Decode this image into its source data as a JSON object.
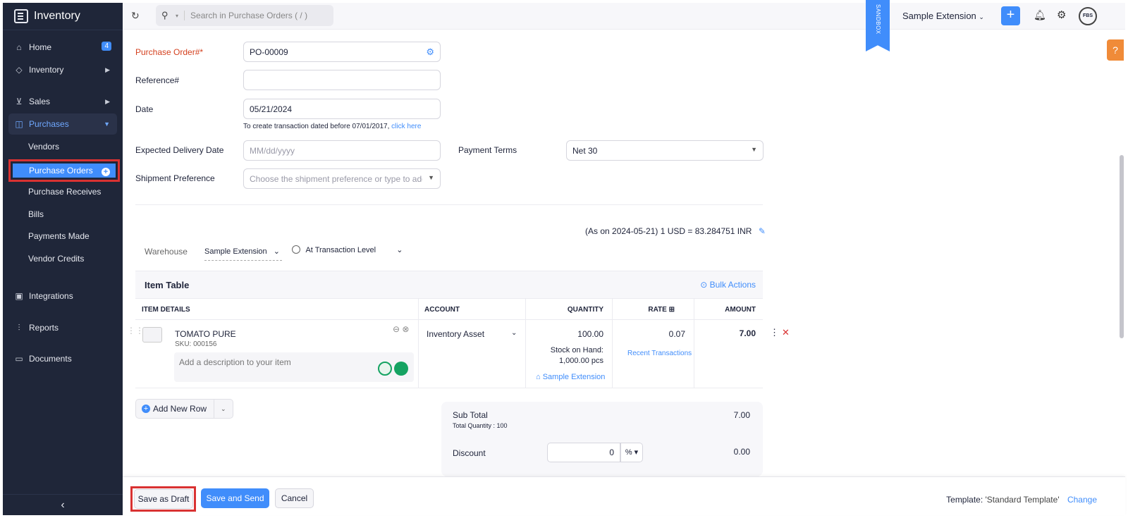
{
  "app": {
    "name": "Inventory"
  },
  "sidebar": {
    "home": {
      "label": "Home",
      "badge": "4"
    },
    "inventory": {
      "label": "Inventory"
    },
    "sales": {
      "label": "Sales"
    },
    "purchases": {
      "label": "Purchases",
      "items": [
        "Vendors",
        "Purchase Orders",
        "Purchase Receives",
        "Bills",
        "Payments Made",
        "Vendor Credits"
      ]
    },
    "integrations": {
      "label": "Integrations"
    },
    "reports": {
      "label": "Reports"
    },
    "documents": {
      "label": "Documents"
    }
  },
  "topbar": {
    "search_placeholder": "Search in Purchase Orders ( / )",
    "sandbox": "SANDBOX",
    "org": "Sample Extension",
    "avatar": "FBS"
  },
  "form": {
    "po_label": "Purchase Order#*",
    "po_value": "PO-00009",
    "ref_label": "Reference#",
    "date_label": "Date",
    "date_value": "05/21/2024",
    "hint": "To create transaction dated before 07/01/2017,",
    "hint_link": "click here",
    "edd_label": "Expected Delivery Date",
    "edd_placeholder": "MM/dd/yyyy",
    "terms_label": "Payment Terms",
    "terms_value": "Net 30",
    "ship_label": "Shipment Preference",
    "ship_placeholder": "Choose the shipment preference or type to add"
  },
  "exchange": "(As on 2024-05-21)  1 USD = 83.284751 INR",
  "warehouse": {
    "label": "Warehouse",
    "value": "Sample Extension",
    "tax_level": "At Transaction Level"
  },
  "item_table": {
    "title": "Item Table",
    "bulk": "Bulk Actions",
    "columns": [
      "ITEM DETAILS",
      "ACCOUNT",
      "QUANTITY",
      "RATE",
      "AMOUNT"
    ],
    "row": {
      "name": "TOMATO PURE",
      "sku": "SKU: 000156",
      "desc_placeholder": "Add a description to your item",
      "account": "Inventory Asset",
      "quantity": "100.00",
      "stock_label": "Stock on Hand:",
      "stock_value": "1,000.00 pcs",
      "warehouse": "Sample Extension",
      "rate": "0.07",
      "recent": "Recent Transactions",
      "amount": "7.00"
    }
  },
  "add_row": "Add New Row",
  "totals": {
    "subtotal_label": "Sub Total",
    "total_qty": "Total Quantity : 100",
    "subtotal_value": "7.00",
    "discount_label": "Discount",
    "discount_input": "0",
    "discount_unit": "%",
    "discount_value": "0.00"
  },
  "footer": {
    "save_draft": "Save as Draft",
    "save_send": "Save and Send",
    "cancel": "Cancel",
    "template_label": "Template:",
    "template_name": "'Standard Template'",
    "change": "Change"
  }
}
